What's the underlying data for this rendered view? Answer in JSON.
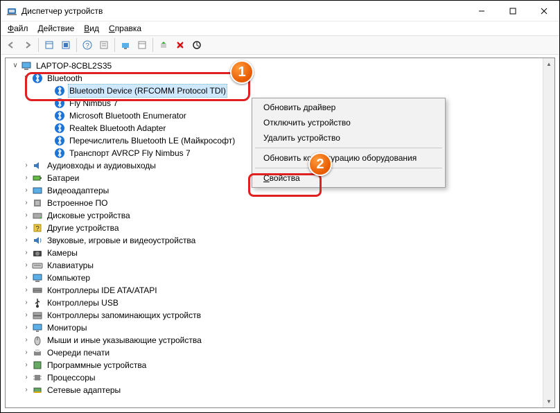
{
  "window": {
    "title": "Диспетчер устройств"
  },
  "menu": {
    "file": "Файл",
    "action": "Действие",
    "view": "Вид",
    "help": "Справка"
  },
  "tree": {
    "root": "LAPTOP-8CBL2S35",
    "bluetooth": "Bluetooth",
    "bt_children": [
      "Bluetooth Device (RFCOMM Protocol TDI)",
      "Fly Nimbus 7",
      "Microsoft Bluetooth Enumerator",
      "Realtek Bluetooth Adapter",
      "Перечислитель Bluetooth LE (Майкрософт)",
      "Транспорт AVRCP Fly Nimbus 7"
    ],
    "categories": [
      "Аудиовходы и аудиовыходы",
      "Батареи",
      "Видеоадаптеры",
      "Встроенное ПО",
      "Дисковые устройства",
      "Другие устройства",
      "Звуковые, игровые и видеоустройства",
      "Камеры",
      "Клавиатуры",
      "Компьютер",
      "Контроллеры IDE ATA/ATAPI",
      "Контроллеры USB",
      "Контроллеры запоминающих устройств",
      "Мониторы",
      "Мыши и иные указывающие устройства",
      "Очереди печати",
      "Программные устройства",
      "Процессоры",
      "Сетевые адаптеры"
    ]
  },
  "context_menu": {
    "update": "Обновить драйвер",
    "disable": "Отключить устройство",
    "uninstall": "Удалить устройство",
    "scan": "Обновить конфигурацию оборудования",
    "properties": "Свойства"
  },
  "badges": {
    "one": "1",
    "two": "2"
  }
}
